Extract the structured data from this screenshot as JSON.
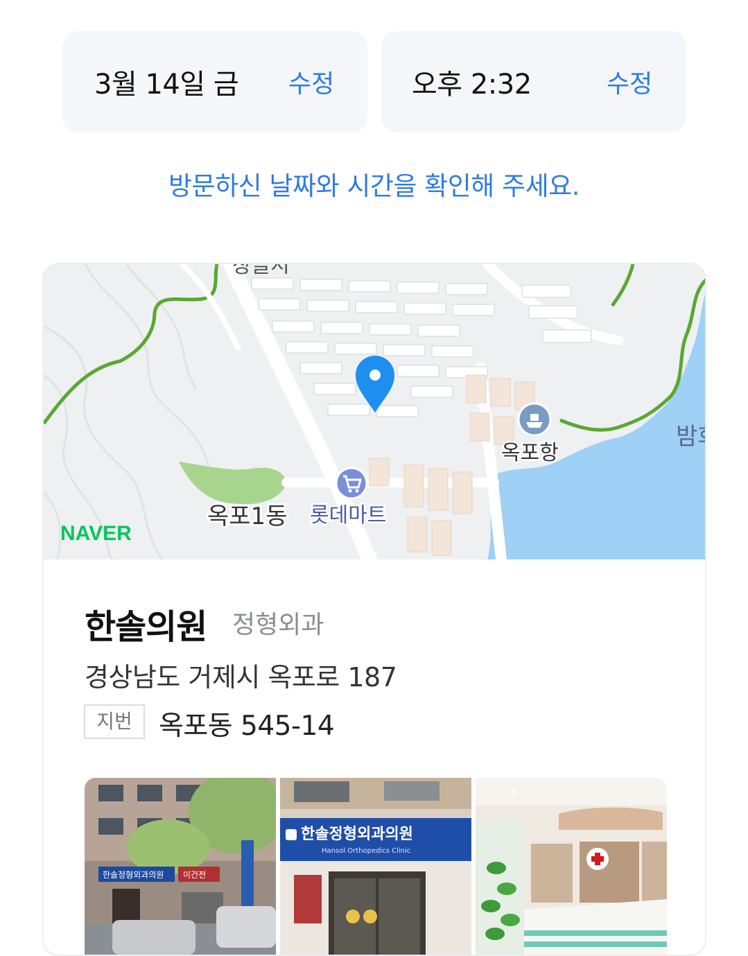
{
  "visit": {
    "date": "3월 14일 금",
    "date_edit": "수정",
    "time": "오후 2:32",
    "time_edit": "수정",
    "notice": "방문하신 날짜와 시간을 확인해 주세요."
  },
  "map": {
    "provider": "NAVER",
    "labels": {
      "top_cut": "장늘시",
      "district": "옥포1동",
      "mart": "롯데마트",
      "port": "옥포항",
      "right_cut": "밤회"
    },
    "colors": {
      "land": "#eef0f2",
      "water": "#9fd0f5",
      "park": "#a8d58e",
      "boundary": "#5aa832",
      "pin": "#1e8ff0",
      "brand": "#03c75a"
    }
  },
  "place": {
    "name": "한솔의원",
    "category": "정형외과",
    "address": "경상남도 거제시 옥포로 187",
    "jibun_label": "지번",
    "jibun_address": "옥포동 545-14"
  },
  "photos": {
    "sign_main": "한솔정형외과의원",
    "sign_sub": "Hansol Orthopedics Clinic",
    "street_sign": "한솔정형외과의원",
    "neighbor_sign": "이건전"
  }
}
